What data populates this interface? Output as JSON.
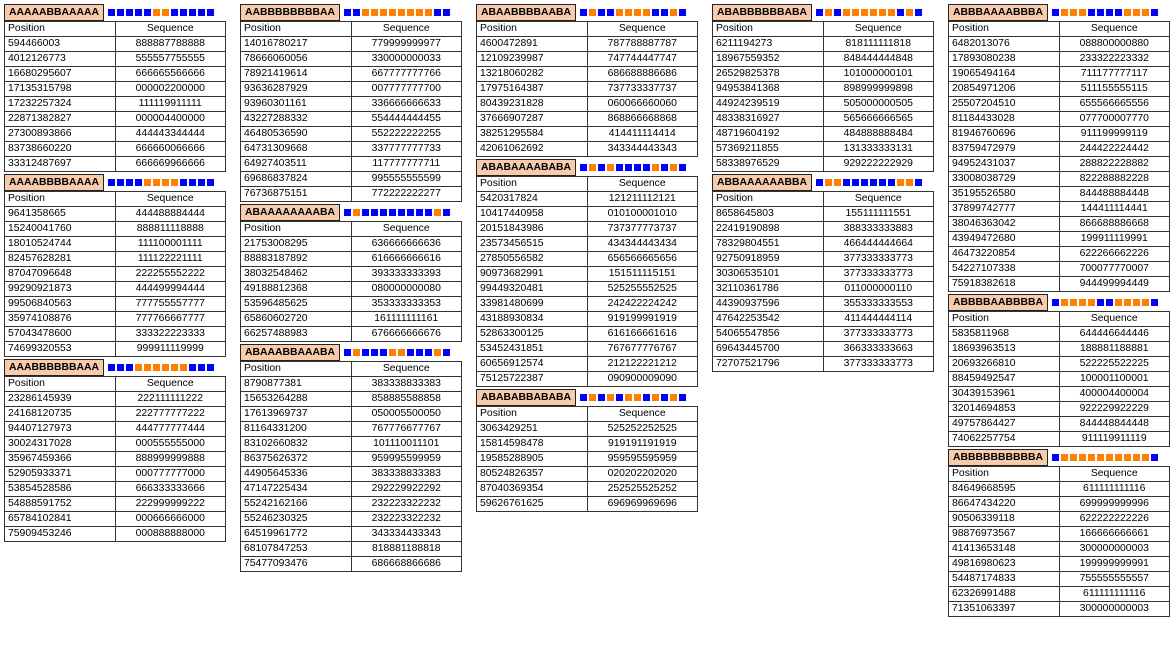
{
  "colors": {
    "A": "#0000ff",
    "B": "#ff7f00",
    "title_bg": "#f8cbad"
  },
  "headers": {
    "position": "Position",
    "sequence": "Sequence"
  },
  "columns": [
    {
      "blocks": [
        {
          "title": "AAAAABBAAAAA",
          "rows": [
            [
              "594466003",
              "888887788888"
            ],
            [
              "4012126773",
              "555557755555"
            ],
            [
              "16680295607",
              "666665566666"
            ],
            [
              "17135315798",
              "000002200000"
            ],
            [
              "17232257324",
              "111119911111"
            ],
            [
              "22871382827",
              "000004400000"
            ],
            [
              "27300893866",
              "444443344444"
            ],
            [
              "83738660220",
              "666660066666"
            ],
            [
              "33312487697",
              "666669966666"
            ]
          ]
        },
        {
          "title": "AAAABBBBAAAA",
          "rows": [
            [
              "9641358665",
              "444488884444"
            ],
            [
              "15240041760",
              "888811118888"
            ],
            [
              "18010524744",
              "111100001111"
            ],
            [
              "82457628281",
              "111122221111"
            ],
            [
              "87047096648",
              "222255552222"
            ],
            [
              "99290921873",
              "444499994444"
            ],
            [
              "99506840563",
              "777755557777"
            ],
            [
              "35974108876",
              "777766667777"
            ],
            [
              "57043478600",
              "333322223333"
            ],
            [
              "74699320553",
              "999911119999"
            ]
          ]
        },
        {
          "title": "AAABBBBBBAAA",
          "rows": [
            [
              "23286145939",
              "222111111222"
            ],
            [
              "24168120735",
              "222777777222"
            ],
            [
              "94407127973",
              "444777777444"
            ],
            [
              "30024317028",
              "000555555000"
            ],
            [
              "35967459366",
              "888999999888"
            ],
            [
              "52905933371",
              "000777777000"
            ],
            [
              "53854528586",
              "666333333666"
            ],
            [
              "54888591752",
              "222999999222"
            ],
            [
              "65784102841",
              "000666666000"
            ],
            [
              "75909453246",
              "000888888000"
            ]
          ]
        }
      ]
    },
    {
      "blocks": [
        {
          "title": "AABBBBBBBBAA",
          "rows": [
            [
              "14016780217",
              "779999999977"
            ],
            [
              "78666060056",
              "330000000033"
            ],
            [
              "78921419614",
              "667777777766"
            ],
            [
              "93636287929",
              "007777777700"
            ],
            [
              "93960301161",
              "336666666633"
            ],
            [
              "43227288332",
              "554444444455"
            ],
            [
              "46480536590",
              "552222222255"
            ],
            [
              "64731309668",
              "337777777733"
            ],
            [
              "64927403511",
              "117777777711"
            ],
            [
              "69686837824",
              "995555555599"
            ],
            [
              "76736875151",
              "772222222277"
            ]
          ]
        },
        {
          "title": "ABAAAAAAAABA",
          "rows": [
            [
              "21753008295",
              "636666666636"
            ],
            [
              "88883187892",
              "616666666616"
            ],
            [
              "38032548462",
              "393333333393"
            ],
            [
              "49188812368",
              "080000000080"
            ],
            [
              "53596485625",
              "353333333353"
            ],
            [
              "65860602720",
              "161111111161"
            ],
            [
              "66257488983",
              "676666666676"
            ]
          ]
        },
        {
          "title": "ABAAABBAAABA",
          "rows": [
            [
              "8790877381",
              "383338833383"
            ],
            [
              "15653264288",
              "858885588858"
            ],
            [
              "17613969737",
              "050005500050"
            ],
            [
              "81164331200",
              "767776677767"
            ],
            [
              "83102660832",
              "101110011101"
            ],
            [
              "86375626372",
              "959995599959"
            ],
            [
              "44905645336",
              "383338833383"
            ],
            [
              "47147225434",
              "292229922292"
            ],
            [
              "55242162166",
              "232223322232"
            ],
            [
              "55246230325",
              "232223322232"
            ],
            [
              "64519961772",
              "343334433343"
            ],
            [
              "68107847253",
              "818881188818"
            ],
            [
              "75477093476",
              "686668866686"
            ]
          ]
        }
      ]
    },
    {
      "blocks": [
        {
          "title": "ABAABBBBAABA",
          "rows": [
            [
              "4600472891",
              "787788887787"
            ],
            [
              "12109239987",
              "747744447747"
            ],
            [
              "13218060282",
              "686688886686"
            ],
            [
              "17975164387",
              "737733337737"
            ],
            [
              "80439231828",
              "060066660060"
            ],
            [
              "37666907287",
              "868866668868"
            ],
            [
              "38251295584",
              "414411114414"
            ],
            [
              "42061062692",
              "343344443343"
            ]
          ]
        },
        {
          "title": "ABABAAAABABA",
          "rows": [
            [
              "5420317824",
              "121211112121"
            ],
            [
              "10417440958",
              "010100001010"
            ],
            [
              "20151843986",
              "737377773737"
            ],
            [
              "23573456515",
              "434344443434"
            ],
            [
              "27850556582",
              "656566665656"
            ],
            [
              "90973682991",
              "151511115151"
            ],
            [
              "99449320481",
              "525255552525"
            ],
            [
              "33981480699",
              "242422224242"
            ],
            [
              "43188930834",
              "919199991919"
            ],
            [
              "52863300125",
              "616166661616"
            ],
            [
              "53452431851",
              "767677776767"
            ],
            [
              "60656912574",
              "212122221212"
            ],
            [
              "75125722387",
              "090900009090"
            ]
          ]
        },
        {
          "title": "ABABABBABABA",
          "rows": [
            [
              "3063429251",
              "525252252525"
            ],
            [
              "15814598478",
              "919191191919"
            ],
            [
              "19585288905",
              "959595595959"
            ],
            [
              "80524826357",
              "020202202020"
            ],
            [
              "87040369354",
              "252525525252"
            ],
            [
              "59626761625",
              "696969969696"
            ]
          ]
        }
      ]
    },
    {
      "blocks": [
        {
          "title": "ABABBBBBBABA",
          "rows": [
            [
              "6211194273",
              "818111111818"
            ],
            [
              "18967559352",
              "848444444848"
            ],
            [
              "26529825378",
              "101000000101"
            ],
            [
              "94953841368",
              "898999999898"
            ],
            [
              "44924239519",
              "505000000505"
            ],
            [
              "48338316927",
              "565666666565"
            ],
            [
              "48719604192",
              "484888888484"
            ],
            [
              "57369211855",
              "131333333131"
            ],
            [
              "58338976529",
              "929222222929"
            ]
          ]
        },
        {
          "title": "ABBAAAAAABBA",
          "rows": [
            [
              "8658645803",
              "155111111551"
            ],
            [
              "22419190898",
              "388333333883"
            ],
            [
              "78329804551",
              "466444444664"
            ],
            [
              "92750918959",
              "377333333773"
            ],
            [
              "30306535101",
              "377333333773"
            ],
            [
              "32110361786",
              "011000000110"
            ],
            [
              "44390937596",
              "355333333553"
            ],
            [
              "47642253542",
              "411444444114"
            ],
            [
              "54065547856",
              "377333333773"
            ],
            [
              "69643445700",
              "366333333663"
            ],
            [
              "72707521796",
              "377333333773"
            ]
          ]
        }
      ]
    },
    {
      "blocks": [
        {
          "title": "ABBBAAAABBBA",
          "rows": [
            [
              "6482013076",
              "088800000880"
            ],
            [
              "17893080238",
              "233322223332"
            ],
            [
              "19065494164",
              "711177777117"
            ],
            [
              "20854971206",
              "511155555115"
            ],
            [
              "25507204510",
              "655566665556"
            ],
            [
              "81184433028",
              "077700007770"
            ],
            [
              "81946760696",
              "911199999119"
            ],
            [
              "83759472979",
              "244422224442"
            ],
            [
              "94952431037",
              "288822228882"
            ],
            [
              "33008038729",
              "822288882228"
            ],
            [
              "35195526580",
              "844488884448"
            ],
            [
              "37899742777",
              "144411114441"
            ],
            [
              "38046363042",
              "866688886668"
            ],
            [
              "43949472680",
              "199911119991"
            ],
            [
              "46473220854",
              "622266662226"
            ],
            [
              "54227107338",
              "700077770007"
            ],
            [
              "75918382618",
              "944499994449"
            ]
          ]
        },
        {
          "title": "ABBBBAABBBBA",
          "rows": [
            [
              "5835811968",
              "644446644446"
            ],
            [
              "18693963513",
              "188881188881"
            ],
            [
              "20693266810",
              "522225522225"
            ],
            [
              "88459492547",
              "100001100001"
            ],
            [
              "30439153961",
              "400004400004"
            ],
            [
              "32014694853",
              "922229922229"
            ],
            [
              "49757864427",
              "844448844448"
            ],
            [
              "74062257754",
              "911119911119"
            ]
          ]
        },
        {
          "title": "ABBBBBBBBBBA",
          "rows": [
            [
              "84649668595",
              "611111111116"
            ],
            [
              "86647434220",
              "699999999996"
            ],
            [
              "90506339118",
              "622222222226"
            ],
            [
              "98876973567",
              "166666666661"
            ],
            [
              "41413653148",
              "300000000003"
            ],
            [
              "49816980623",
              "199999999991"
            ],
            [
              "54487174833",
              "755555555557"
            ],
            [
              "62326991488",
              "611111111116"
            ],
            [
              "71351063397",
              "300000000003"
            ]
          ]
        }
      ]
    }
  ]
}
